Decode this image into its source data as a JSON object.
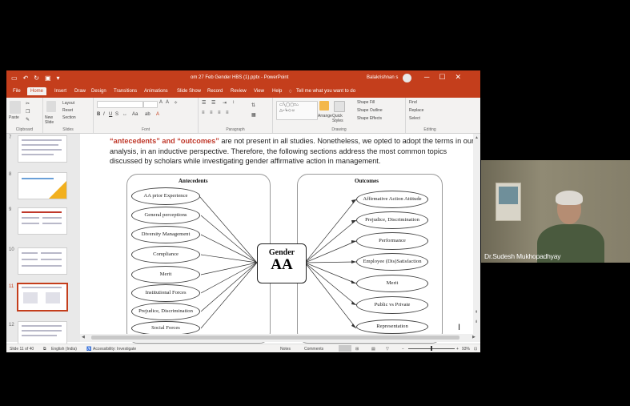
{
  "titlebar": {
    "doc_title": "om 27 Feb Gender HBS (1).pptx - PowerPoint",
    "user_name": "Balakrishnan s",
    "window_controls": [
      "─",
      "☐",
      "✕"
    ]
  },
  "menu": {
    "tabs": [
      "File",
      "Home",
      "Insert",
      "Draw",
      "Design",
      "Transitions",
      "Animations",
      "Slide Show",
      "Record",
      "Review",
      "View",
      "Help"
    ],
    "active_tab": "Home",
    "tell_me": "Tell me what you want to do"
  },
  "ribbon": {
    "groups": [
      "Clipboard",
      "Slides",
      "Font",
      "Paragraph",
      "Drawing",
      "Editing"
    ],
    "paste_label": "Paste",
    "new_slide_label": "New Slide",
    "layout_label": "Layout",
    "reset_label": "Reset",
    "section_label": "Section",
    "arrange_label": "Arrange",
    "quick_styles_label": "Quick Styles",
    "shape_fill": "Shape Fill",
    "shape_outline": "Shape Outline",
    "shape_effects": "Shape Effects",
    "find": "Find",
    "replace": "Replace",
    "select": "Select"
  },
  "thumbnails": [
    {
      "num": "7"
    },
    {
      "num": "8"
    },
    {
      "num": "9"
    },
    {
      "num": "10"
    },
    {
      "num": "11",
      "selected": true
    },
    {
      "num": "12"
    }
  ],
  "slide": {
    "para_bold": "“antecedents” and “outcomes”",
    "para_text": " are not present in all studies. Nonetheless, we opted to adopt the terms in our analysis, in an inductive perspective. Therefore, the following sections address the most common topics discussed by scholars while investigating gender affirmative action in management.",
    "antecedents_title": "Antecedents",
    "outcomes_title": "Outcomes",
    "center_line1": "Gender",
    "center_line2": "AA",
    "antecedents": [
      "AA prior Experience",
      "General perceptions",
      "Diversity Management",
      "Compliance",
      "Merit",
      "Institutional Forces",
      "Prejudice, Discrimination",
      "Social Forces"
    ],
    "outcomes": [
      "Affirmative Action Attitude",
      "Prejudice, Discrimination",
      "Performance",
      "Employee (Dis)Satisfaction",
      "Merit",
      "Public vs Private",
      "Representation"
    ]
  },
  "status": {
    "slide_info": "Slide 11 of 40",
    "language": "English (India)",
    "accessibility": "Accessibility: Investigate",
    "notes": "Notes",
    "comments": "Comments",
    "zoom": "93%"
  },
  "video": {
    "participant_name": "Dr.Sudesh Mukhopadhyay"
  },
  "colors": {
    "accent": "#c43e1c",
    "emphasis_text": "#c0392b"
  }
}
